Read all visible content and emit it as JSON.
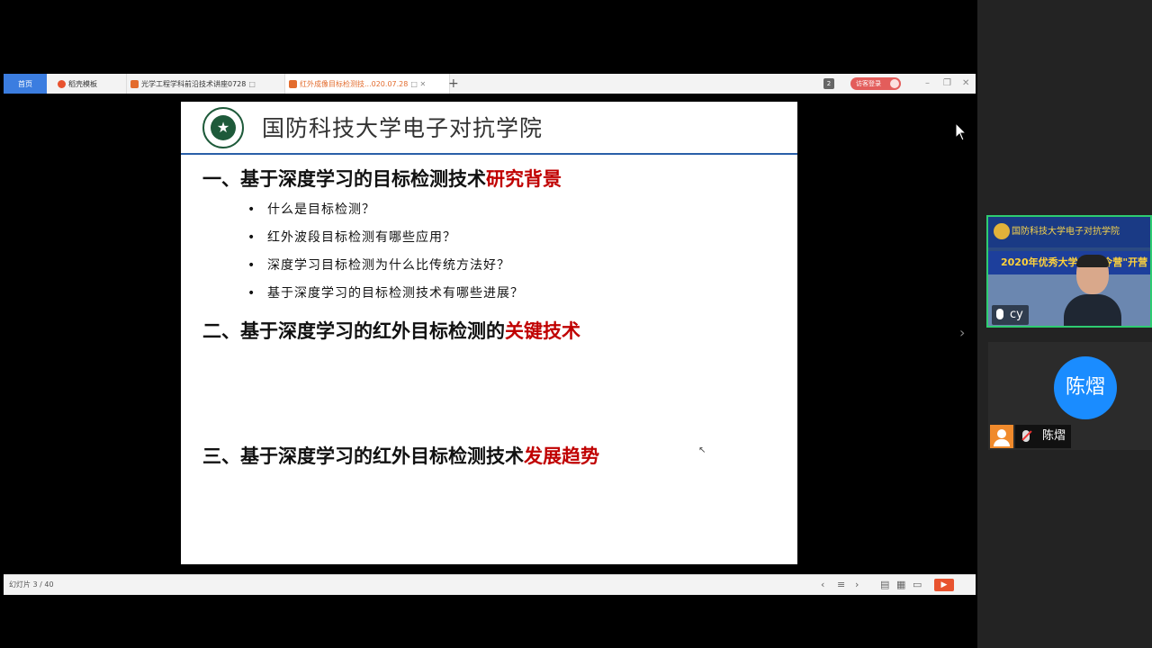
{
  "browser": {
    "tabs": [
      {
        "label": "首页"
      },
      {
        "label": "稻壳模板"
      },
      {
        "label": "光学工程学科前沿技术讲座0728",
        "suffix": "□"
      },
      {
        "label": "红外成像目标检测技...020.07.28",
        "suffix": "□ ✕"
      }
    ],
    "new_tab": "+",
    "badge": "2",
    "login": "访客登录"
  },
  "slide": {
    "school": "国防科技大学电子对抗学院",
    "logo_glyph": "★",
    "section1": {
      "black": "一、基于深度学习的目标检测技术",
      "red": "研究背景"
    },
    "bullets": [
      "什么是目标检测？",
      "红外波段目标检测有哪些应用？",
      "深度学习目标检测为什么比传统方法好？",
      "基于深度学习的目标检测技术有哪些进展？"
    ],
    "section2": {
      "black": "二、基于深度学习的红外目标检测的",
      "red": "关键技术"
    },
    "section3": {
      "black": "三、基于深度学习的红外目标检测技术",
      "red": "发展趋势"
    }
  },
  "status": {
    "slide_count": "幻灯片 3 / 40"
  },
  "participants": {
    "video_banner": "国防科技大学电子对抗学院",
    "video_sub": "2020年优秀大学生\"夏令营\"开营",
    "video_name": "cy",
    "audio_name": "陈熠",
    "audio_avatar": "陈熠"
  },
  "colors": {
    "accent_red": "#c00000",
    "header_line": "#2a5fa8",
    "speaking_border": "#2ecc71",
    "avatar_blue": "#1a8cff"
  }
}
